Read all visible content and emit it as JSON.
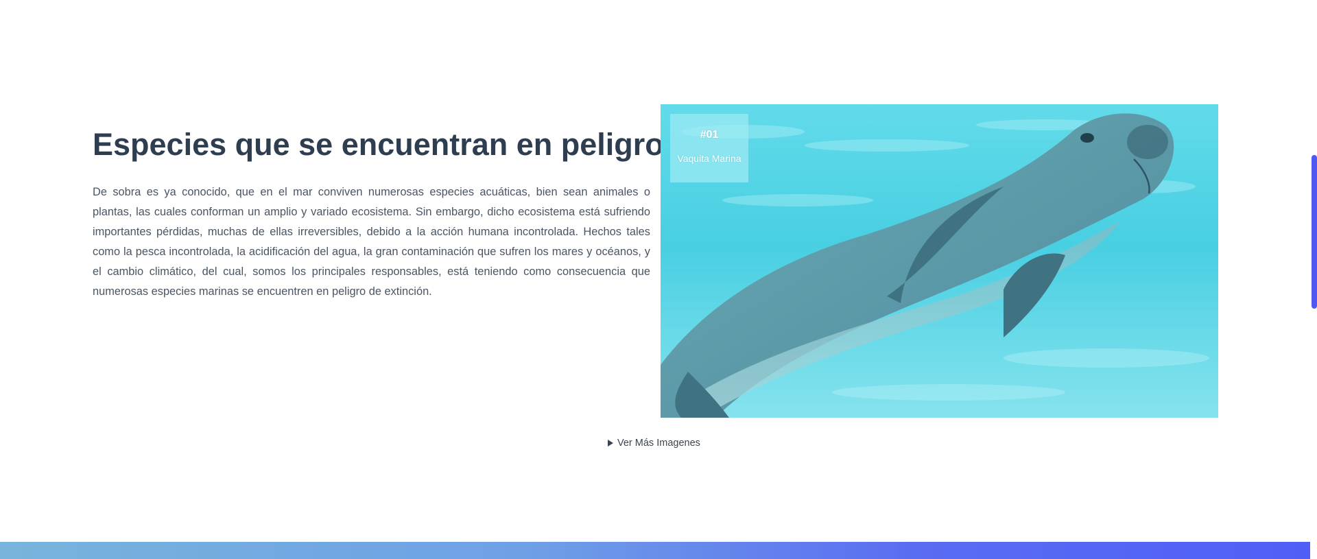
{
  "section": {
    "title": "Especies que se encuentran en peligro",
    "paragraph": "De sobra es ya conocido, que en el mar conviven numerosas especies acuáticas, bien sean animales o plantas, las cuales conforman un amplio y variado ecosistema. Sin embargo, dicho ecosistema está sufriendo importantes pérdidas, muchas de ellas irreversibles, debido a la acción humana incontrolada. Hechos tales como la pesca incontrolada, la acidificación del agua, la gran contaminación que sufren los mares y océanos, y el cambio climático, del cual, somos los principales responsables, está teniendo como consecuencia que numerosas especies marinas se encuentren en peligro de extinción."
  },
  "gallery": {
    "badge_number": "#01",
    "badge_name": "Vaquita Marina",
    "image_icon": "vaquita-porpoise-photo",
    "more_label": "Ver Más Imagenes",
    "toggle_icon": "triangle-right-icon"
  },
  "colors": {
    "title": "#2e3e50",
    "body_text": "#4a5563",
    "water": "#3fcbe0",
    "band_start": "#78b4dc",
    "band_end": "#505ef7",
    "scrollbar": "#5158f2"
  }
}
